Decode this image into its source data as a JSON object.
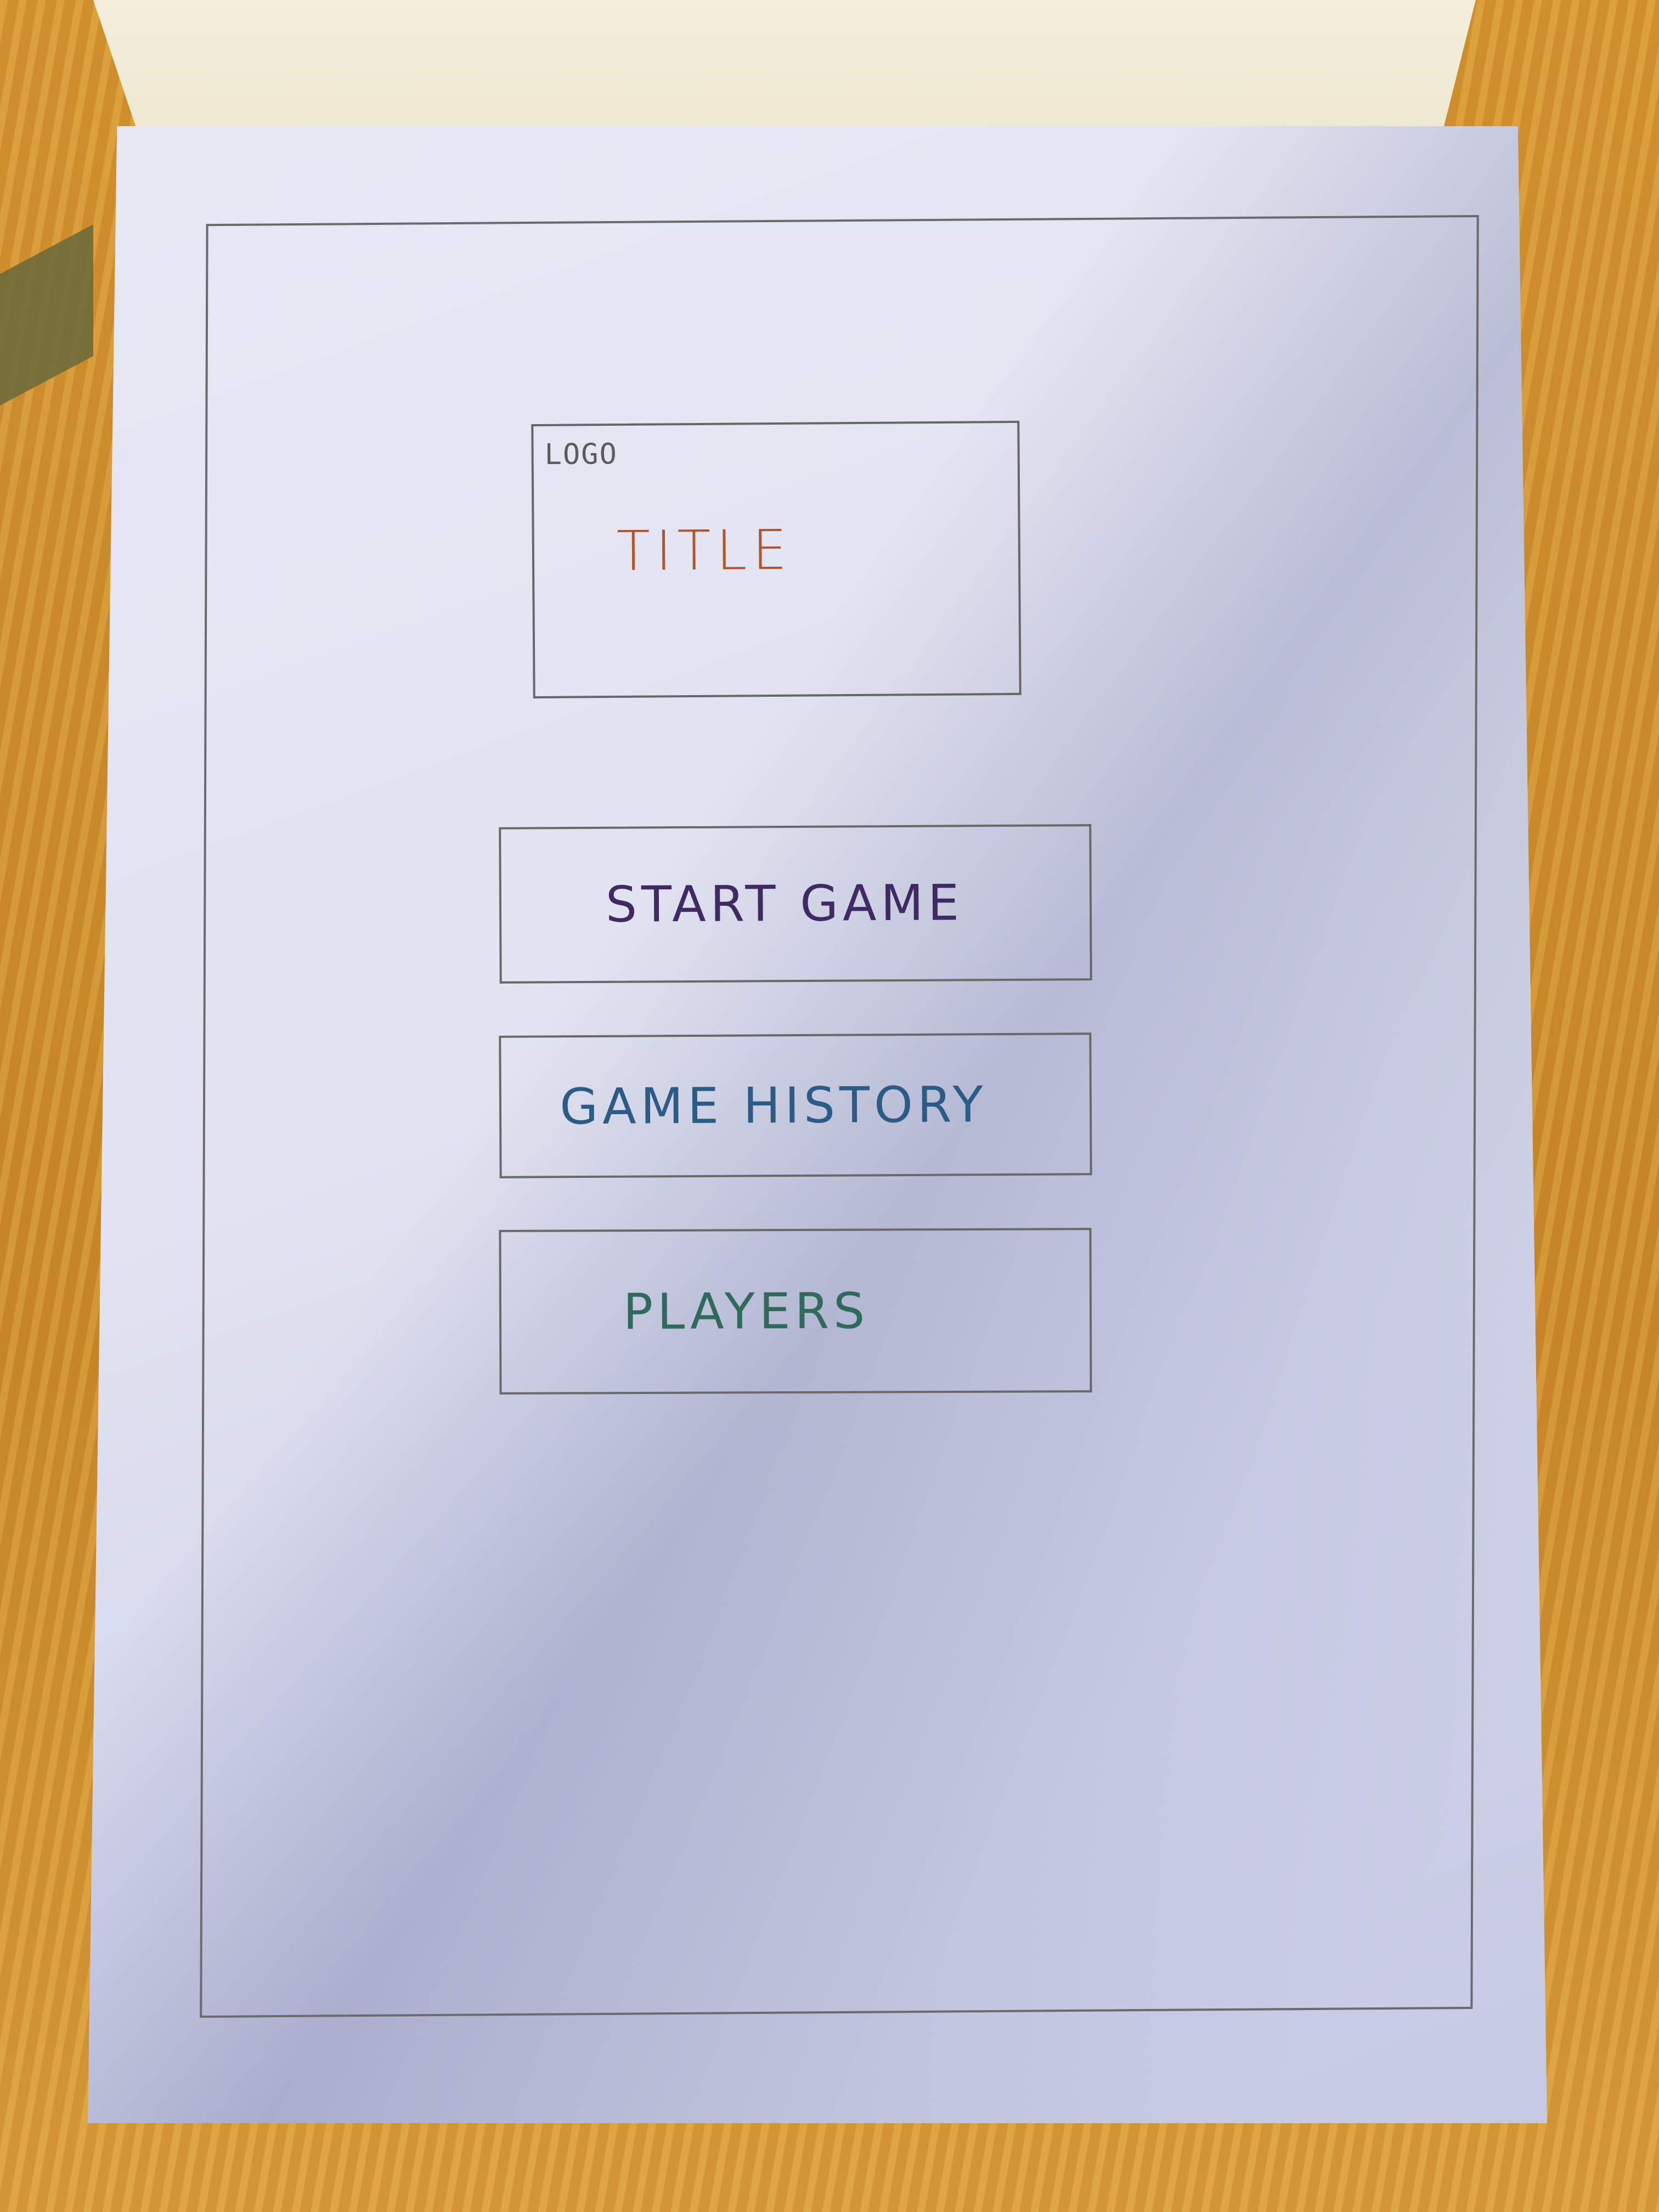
{
  "mockup": {
    "logo_label": "LOGO",
    "title": "TITLE",
    "menu": [
      {
        "label": "START  GAME",
        "color": "#3f2a63"
      },
      {
        "label": "GAME  HISTORY",
        "color": "#2c5c86"
      },
      {
        "label": "PLAYERS",
        "color": "#2f6a5a"
      }
    ]
  }
}
